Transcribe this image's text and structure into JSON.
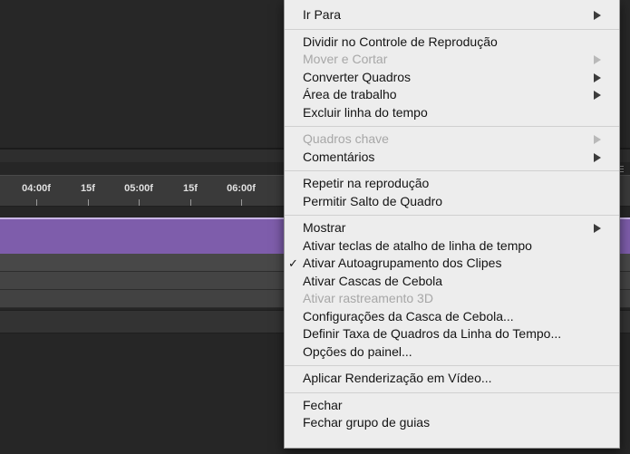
{
  "timeline": {
    "ruler_labels": [
      "04:00f",
      "15f",
      "05:00f",
      "15f",
      "06:00f"
    ]
  },
  "menu": {
    "groups": [
      [
        {
          "label": "Ir Para",
          "submenu": true,
          "enabled": true
        }
      ],
      [
        {
          "label": "Dividir no Controle de Reprodução",
          "submenu": false,
          "enabled": true
        },
        {
          "label": "Mover e Cortar",
          "submenu": true,
          "enabled": false
        },
        {
          "label": "Converter Quadros",
          "submenu": true,
          "enabled": true
        },
        {
          "label": "Área de trabalho",
          "submenu": true,
          "enabled": true
        },
        {
          "label": "Excluir linha do tempo",
          "submenu": false,
          "enabled": true
        }
      ],
      [
        {
          "label": "Quadros chave",
          "submenu": true,
          "enabled": false
        },
        {
          "label": "Comentários",
          "submenu": true,
          "enabled": true
        }
      ],
      [
        {
          "label": "Repetir na reprodução",
          "submenu": false,
          "enabled": true
        },
        {
          "label": "Permitir Salto de Quadro",
          "submenu": false,
          "enabled": true
        }
      ],
      [
        {
          "label": "Mostrar",
          "submenu": true,
          "enabled": true
        },
        {
          "label": "Ativar teclas de atalho de linha de tempo",
          "submenu": false,
          "enabled": true
        },
        {
          "label": "Ativar Autoagrupamento dos Clipes",
          "submenu": false,
          "enabled": true,
          "checked": true
        },
        {
          "label": "Ativar Cascas de Cebola",
          "submenu": false,
          "enabled": true
        },
        {
          "label": "Ativar rastreamento 3D",
          "submenu": false,
          "enabled": false
        },
        {
          "label": "Configurações da Casca de Cebola...",
          "submenu": false,
          "enabled": true
        },
        {
          "label": "Definir Taxa de Quadros da Linha do Tempo...",
          "submenu": false,
          "enabled": true
        },
        {
          "label": "Opções do painel...",
          "submenu": false,
          "enabled": true
        }
      ],
      [
        {
          "label": "Aplicar Renderização em Vídeo...",
          "submenu": false,
          "enabled": true
        }
      ],
      [
        {
          "label": "Fechar",
          "submenu": false,
          "enabled": true
        },
        {
          "label": "Fechar grupo de guias",
          "submenu": false,
          "enabled": true
        }
      ]
    ],
    "check_glyph": "✓"
  }
}
